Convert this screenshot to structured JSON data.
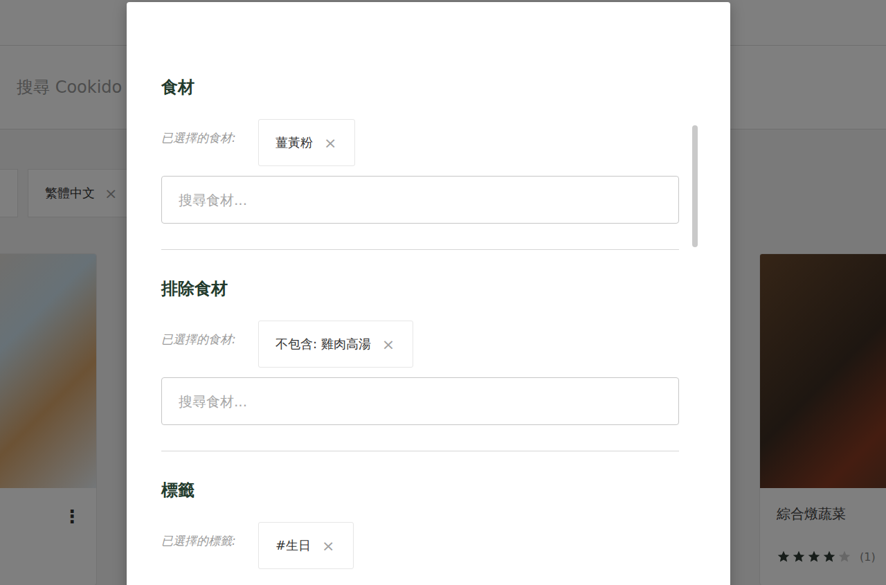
{
  "page": {
    "search": {
      "placeholder": "搜尋 Cookido"
    },
    "filters": [
      {
        "label": "繁體中文",
        "remove": "×"
      }
    ],
    "recipes": [
      {
        "menu": "⋮"
      },
      {
        "title": "綜合燉蔬菜",
        "stars": 4,
        "rating_count": "(1)"
      }
    ]
  },
  "modal": {
    "sections": [
      {
        "title": "食材",
        "selected_label": "已選擇的食材:",
        "chips": [
          {
            "label": "薑黃粉",
            "remove": "×"
          }
        ],
        "search": {
          "placeholder": "搜尋食材..."
        }
      },
      {
        "title": "排除食材",
        "selected_label": "已選擇的食材:",
        "chips": [
          {
            "label": "不包含: 雞肉高湯",
            "remove": "×"
          }
        ],
        "search": {
          "placeholder": "搜尋食材..."
        }
      },
      {
        "title": "標籤",
        "selected_label": "已選擇的標籤:",
        "chips": [
          {
            "label": "#生日",
            "remove": "×"
          }
        ]
      }
    ]
  }
}
